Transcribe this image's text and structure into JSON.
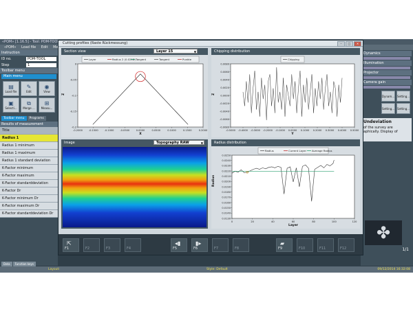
{
  "background_app": {
    "title": "«POM» [1.16.5] - Tool: POM-TOOL loaded",
    "menu": [
      "«POM»",
      "Load file",
      "Edit",
      "Measure"
    ],
    "left": {
      "instruction_head": "Instruction",
      "id_label": "ID no.",
      "id_value": "POM-TOOL",
      "step_label": "Step",
      "step_value": "1",
      "toolbar_head": "Toolbar menu",
      "main_menu": "Main menu",
      "tools": [
        "Load file",
        "Edit",
        "View",
        "Selecti...",
        "Merge ...",
        "Measu..."
      ],
      "tabs": [
        "Toolbar menu",
        "Programs"
      ],
      "results_head": "Results of measurement",
      "rows": [
        "Title",
        "Radius 1",
        "Radius 1 minimum",
        "Radius 1 maximum",
        "Radius 1 standard deviation",
        "K-Factor minimum",
        "K-Factor maximum",
        "K-Factor standarddeviation",
        "K-Factor Dr",
        "K-Factor minimum Dr",
        "K-Factor maximum Dr",
        "K-Factor standarddeviation Dr"
      ],
      "bottom_tabs": [
        "Data",
        "Function keys"
      ]
    },
    "right": {
      "rows": [
        "Dynamics",
        "Illumination",
        "Projector",
        "Camera gain"
      ],
      "tools": [
        "Dynam...",
        "Setting...",
        "Setting...",
        "Setting..."
      ],
      "text_title": "Undeviation",
      "text_lines": [
        "of the survey are",
        "aphically. Display of"
      ],
      "pager": "1/1"
    },
    "status": {
      "layout": "Layout:",
      "style": "Style: Default",
      "datetime": "09/12/2014 16:32:08"
    }
  },
  "dialog": {
    "title": "Cutting profiles (Raste Rückmessung)",
    "section": {
      "title": "Section view",
      "combo": "Layer 15",
      "legend": [
        "Layer",
        "Radius 2 (0.0218)",
        "Tangent",
        "Tangent",
        "Punkte"
      ],
      "xticks": [
        "-0.2000",
        "-0.1500",
        "-0.1000",
        "-0.0500",
        "0.0000",
        "0.0500",
        "0.1000",
        "0.1500",
        "0.2000"
      ],
      "xlabel": "X",
      "ylabel": "Z",
      "yticks": [
        "0",
        "-0.05",
        "-0.1",
        "-0.15",
        "-0.2"
      ]
    },
    "chipping": {
      "title": "Chipping distribution",
      "legend": [
        "Chipping"
      ],
      "yticks": [
        "0.0080",
        "0.0060",
        "0.0040",
        "0.0020",
        "0.0000",
        "-0.0020",
        "-0.0040",
        "-0.0060",
        "-0.0080"
      ],
      "xticks": [
        "-0.5000",
        "-0.4000",
        "-0.3000",
        "-0.2000",
        "-0.1000",
        "0.0000",
        "0.1000",
        "0.2000",
        "0.3000",
        "0.4000",
        "0.5000"
      ],
      "xlabel": "Y",
      "ylabel": "Z"
    },
    "image": {
      "title": "Image",
      "combo": "Topography RAW"
    },
    "radius": {
      "title": "Radius distribution",
      "legend": [
        "Radius",
        "Current Layer",
        "Average Radius"
      ],
      "yticks": [
        "0.0250",
        "0.0240",
        "0.0230",
        "0.0220",
        "0.0210",
        "0.0200",
        "0.0190",
        "0.0180",
        "0.0170",
        "0.0160",
        "0.0150",
        "0.0140",
        "0.0130"
      ],
      "xticks": [
        "0",
        "20",
        "40",
        "60",
        "80",
        "100",
        "120"
      ],
      "xlabel": "Layer",
      "ylabel": "Radius"
    },
    "fkeys": [
      "F1",
      "F2",
      "F3",
      "F4",
      "F5",
      "F6",
      "F7",
      "F8",
      "F9",
      "F10",
      "F11",
      "F12"
    ]
  },
  "chart_data": [
    {
      "type": "line",
      "title": "Section view",
      "xlabel": "X",
      "ylabel": "Z",
      "xlim": [
        -0.25,
        0.25
      ],
      "ylim": [
        -0.22,
        0.03
      ],
      "series": [
        {
          "name": "Layer",
          "x": [
            -0.19,
            0.0,
            0.19
          ],
          "y": [
            -0.21,
            -0.01,
            -0.21
          ]
        },
        {
          "name": "Radius 2 (0.0218)",
          "center": [
            0.0,
            -0.02
          ],
          "r": 0.02
        }
      ]
    },
    {
      "type": "line",
      "title": "Chipping distribution",
      "xlabel": "Y",
      "ylabel": "Z",
      "xlim": [
        -0.5,
        0.5
      ],
      "ylim": [
        -0.009,
        0.009
      ],
      "series": [
        {
          "name": "Chipping",
          "values": [
            0.001,
            -0.003,
            0.004,
            -0.002,
            0.006,
            -0.005,
            0.002,
            0.007,
            -0.004,
            0.001,
            -0.006,
            0.005,
            -0.001,
            0.003,
            -0.007,
            0.004,
            0.006,
            -0.003,
            0.002,
            -0.005,
            0.008,
            -0.002,
            0.001,
            -0.004,
            0.005,
            -0.006,
            0.003,
            0.0,
            -0.003,
            0.006,
            -0.001,
            0.004,
            -0.005,
            0.002,
            0.007,
            -0.006,
            0.003,
            -0.002,
            0.005,
            -0.004,
            0.001,
            0.006,
            -0.005,
            0.002,
            -0.003,
            0.004,
            -0.001,
            0.005,
            -0.004,
            0.002,
            0.006,
            -0.003,
            0.001,
            -0.005,
            0.004,
            0.002,
            -0.006,
            0.003,
            -0.002,
            0.005
          ]
        }
      ]
    },
    {
      "type": "line",
      "title": "Radius distribution",
      "xlabel": "Layer",
      "ylabel": "Radius",
      "xlim": [
        0,
        120
      ],
      "ylim": [
        0.0125,
        0.0255
      ],
      "series": [
        {
          "name": "Radius",
          "x": [
            0,
            3,
            6,
            9,
            12,
            15,
            18,
            21,
            24,
            27,
            30,
            33,
            36,
            39,
            42,
            45,
            48,
            51,
            54,
            57,
            60,
            63,
            66,
            69,
            72,
            75,
            78,
            81,
            84,
            87,
            90,
            93,
            96,
            99,
            100
          ],
          "y": [
            0.0218,
            0.0222,
            0.022,
            0.0225,
            0.0219,
            0.022,
            0.0223,
            0.0226,
            0.0228,
            0.0226,
            0.0229,
            0.0227,
            0.023,
            0.0231,
            0.0229,
            0.0232,
            0.023,
            0.0175,
            0.0228,
            0.0231,
            0.02,
            0.0229,
            0.019,
            0.0232,
            0.0235,
            0.0228,
            0.016,
            0.0226,
            0.023,
            0.0234,
            0.0229,
            0.0236,
            0.0233,
            0.0238,
            0.0245
          ]
        },
        {
          "name": "Average Radius",
          "x": [
            0,
            100
          ],
          "y": [
            0.0222,
            0.0222
          ]
        }
      ],
      "current_layer": 15
    }
  ]
}
